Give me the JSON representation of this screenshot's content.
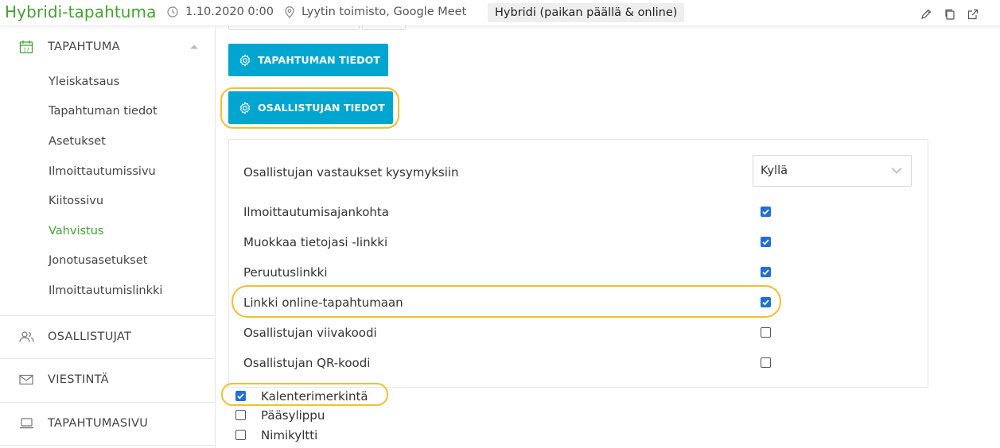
{
  "header": {
    "title": "Hybridi-tapahtuma",
    "datetime": "1.10.2020 0:00",
    "location": "Lyytin toimisto, Google Meet",
    "event_type": "Hybridi (paikan päällä & online)"
  },
  "sidebar": {
    "event_section": "TAPAHTUMA",
    "items": [
      {
        "label": "Yleiskatsaus"
      },
      {
        "label": "Tapahtuman tiedot"
      },
      {
        "label": "Asetukset"
      },
      {
        "label": "Ilmoittautumissivu"
      },
      {
        "label": "Kiitossivu"
      },
      {
        "label": "Vahvistus",
        "current": true
      },
      {
        "label": "Jonotusasetukset"
      },
      {
        "label": "Ilmoittautumislinkki"
      }
    ],
    "participants_section": "OSALLISTUJAT",
    "messaging_section": "VIESTINTÄ",
    "eventpage_section": "TAPAHTUMASIVU"
  },
  "main": {
    "event_details_button": "TAPAHTUMAN TIEDOT",
    "participant_details_button": "OSALLISTUJAN TIEDOT",
    "answers_row": {
      "label": "Osallistujan vastaukset kysymyksiin",
      "value": "Kyllä"
    },
    "rows": [
      {
        "label": "Ilmoittautumisajankohta",
        "checked": true
      },
      {
        "label": "Muokkaa tietojasi -linkki",
        "checked": true
      },
      {
        "label": "Peruutuslinkki",
        "checked": true
      },
      {
        "label": "Linkki online-tapahtumaan",
        "checked": true
      },
      {
        "label": "Osallistujan viivakoodi",
        "checked": false
      },
      {
        "label": "Osallistujan QR-koodi",
        "checked": false
      }
    ],
    "extras": [
      {
        "label": "Kalenterimerkintä",
        "checked": true
      },
      {
        "label": "Pääsylippu",
        "checked": false
      },
      {
        "label": "Nimikyltti",
        "checked": false
      }
    ]
  },
  "colors": {
    "brand_green": "#3fa52d",
    "primary_button": "#00a6d0",
    "highlight_ring": "#f5be2c",
    "checkbox_checked": "#1f6fd6"
  },
  "icons": [
    "clock-icon",
    "location-pin-icon",
    "edit-icon",
    "copy-icon",
    "external-link-icon",
    "calendar-icon",
    "chevron-up-icon",
    "users-icon",
    "envelope-icon",
    "laptop-icon",
    "gear-icon",
    "chevron-down-icon",
    "checkmark-icon"
  ]
}
